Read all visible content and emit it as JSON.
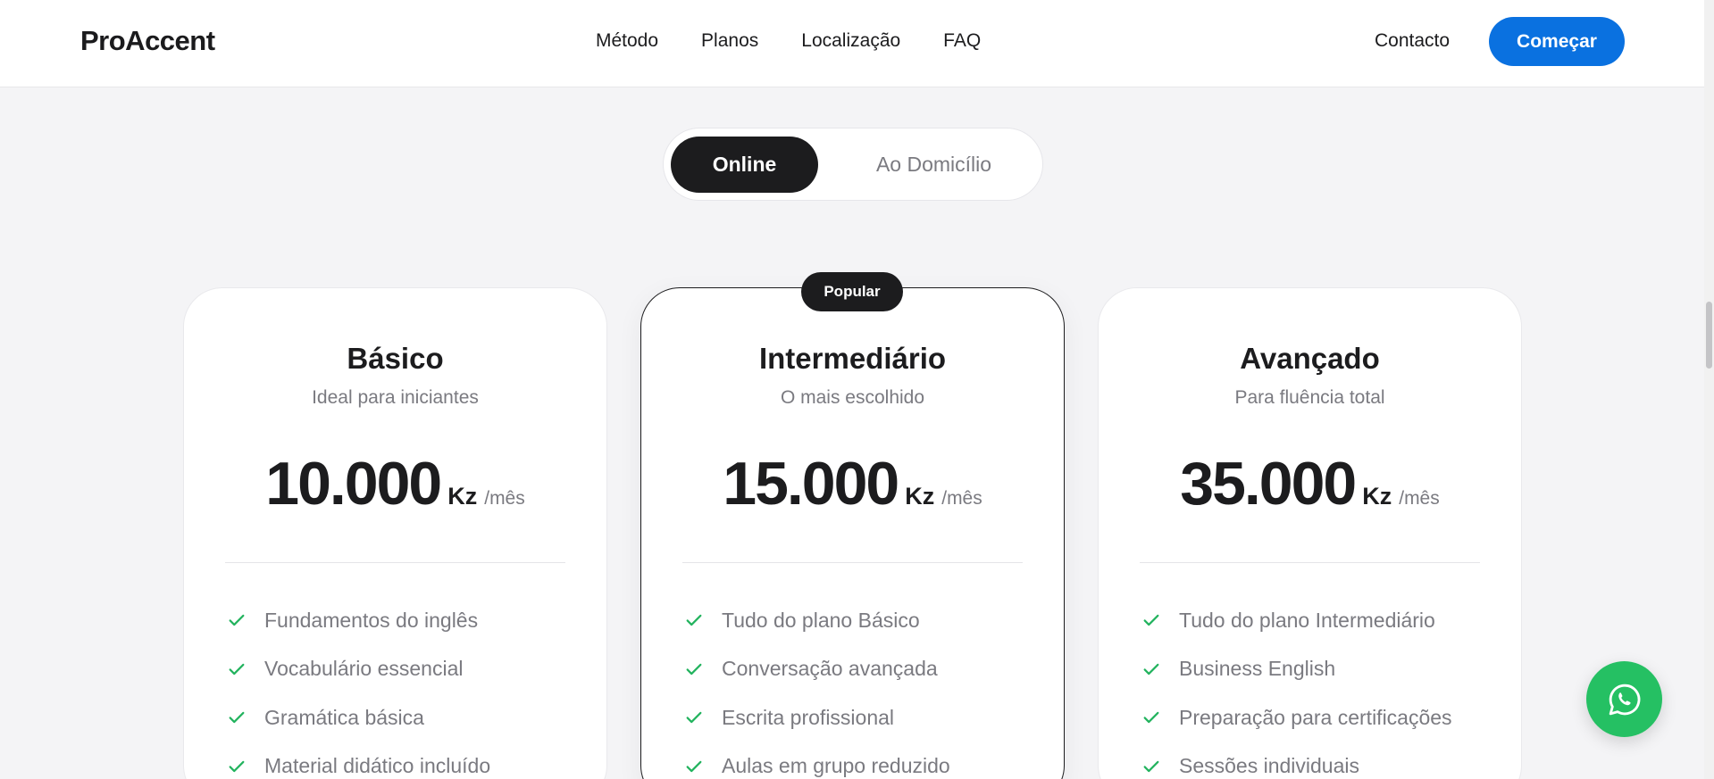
{
  "header": {
    "brand": "ProAccent",
    "nav": [
      "Método",
      "Planos",
      "Localização",
      "FAQ"
    ],
    "contact_label": "Contacto",
    "cta_label": "Começar"
  },
  "toggle": {
    "options": [
      "Online",
      "Ao Domicílio"
    ],
    "selected": "Online"
  },
  "plans": [
    {
      "name": "Básico",
      "subtitle": "Ideal para iniciantes",
      "price": "10.000",
      "currency": "Kz",
      "period": "/mês",
      "features": [
        "Fundamentos do inglês",
        "Vocabulário essencial",
        "Gramática básica",
        "Material didático incluído"
      ]
    },
    {
      "name": "Intermediário",
      "subtitle": "O mais escolhido",
      "price": "15.000",
      "currency": "Kz",
      "period": "/mês",
      "badge": "Popular",
      "features": [
        "Tudo do plano Básico",
        "Conversação avançada",
        "Escrita profissional",
        "Aulas em grupo reduzido"
      ]
    },
    {
      "name": "Avançado",
      "subtitle": "Para fluência total",
      "price": "35.000",
      "currency": "Kz",
      "period": "/mês",
      "features": [
        "Tudo do plano Intermediário",
        "Business English",
        "Preparação para certificações",
        "Sessões individuais"
      ]
    }
  ],
  "icons": {
    "check": "check-icon",
    "whatsapp": "whatsapp-icon"
  },
  "colors": {
    "accent": "#0a71e0",
    "dark": "#1c1c1e",
    "check": "#22b35e",
    "whatsapp": "#25c063",
    "muted": "#7a7a80"
  }
}
